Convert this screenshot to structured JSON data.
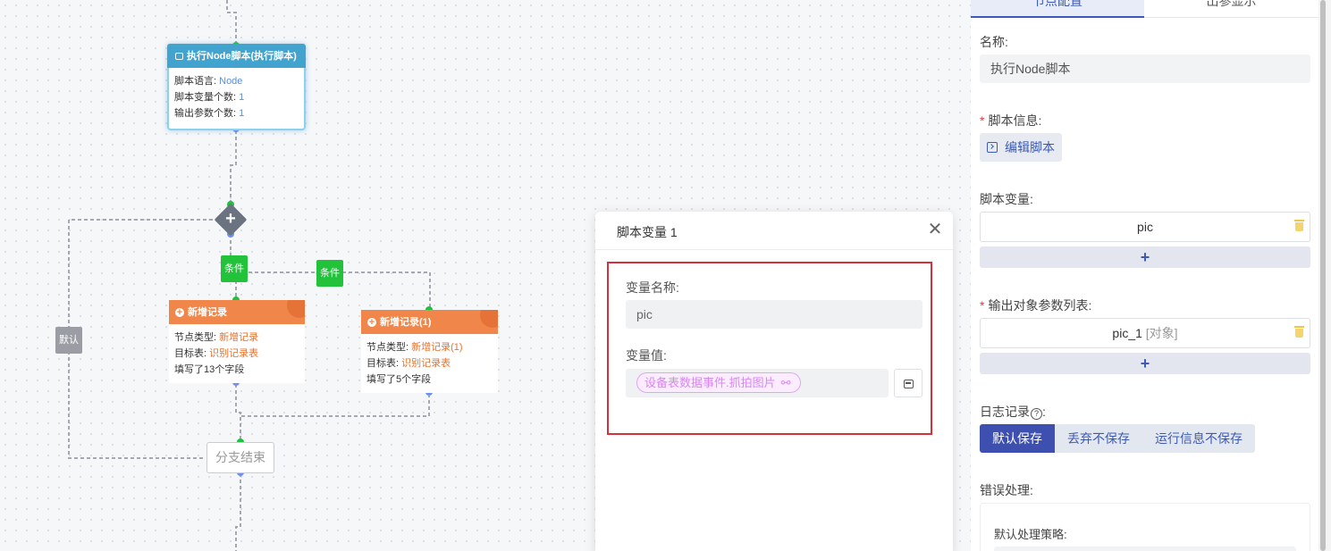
{
  "canvas": {
    "script_node": {
      "title": "执行Node脚本(执行脚本)",
      "rows": [
        {
          "label": "脚本语言: ",
          "value": "Node"
        },
        {
          "label": "脚本变量个数: ",
          "value": "1"
        },
        {
          "label": "输出参数个数: ",
          "value": "1"
        }
      ]
    },
    "gateway_icon": "plus-icon",
    "condition_label_1": "条件",
    "condition_label_2": "条件",
    "default_label": "默认",
    "record_node_1": {
      "title": "新增记录",
      "rows": [
        {
          "label": "节点类型: ",
          "value": "新增记录"
        },
        {
          "label": "目标表: ",
          "value": "识别记录表"
        },
        {
          "label": "填写了13个字段",
          "value": ""
        }
      ]
    },
    "record_node_2": {
      "title": "新增记录(1)",
      "rows": [
        {
          "label": "节点类型: ",
          "value": "新增记录(1)"
        },
        {
          "label": "目标表: ",
          "value": "识别记录表"
        },
        {
          "label": "填写了5个字段",
          "value": ""
        }
      ]
    },
    "branch_end": "分支结束"
  },
  "modal": {
    "title": "脚本变量 1",
    "close_icon": "close-icon",
    "name_label": "变量名称:",
    "name_value": "pic",
    "value_label": "变量值:",
    "value_chip": "设备表数据事件.抓拍图片"
  },
  "panel": {
    "tabs": [
      "节点配置",
      "出参显示"
    ],
    "name_label": "名称:",
    "name_value": "执行Node脚本",
    "script_info_label": "脚本信息:",
    "edit_script_button": "编辑脚本",
    "script_vars_label": "脚本变量:",
    "script_vars": [
      "pic"
    ],
    "add_label": "+",
    "output_params_label": "输出对象参数列表:",
    "output_params": [
      {
        "name": "pic_1",
        "type": "[对象]"
      }
    ],
    "log_label": "日志记录",
    "log_help": "?",
    "log_options": [
      "默认保存",
      "丢弃不保存",
      "运行信息不保存"
    ],
    "log_selected": "默认保存",
    "error_label": "错误处理:",
    "default_strategy_label": "默认处理策略:"
  },
  "colors": {
    "accent": "#3d50b0",
    "script_node_header": "#43a3cf",
    "record_node_header": "#f0864a",
    "condition": "#22c23a",
    "highlight_border": "#d6303c",
    "chip": "#d986f5"
  }
}
